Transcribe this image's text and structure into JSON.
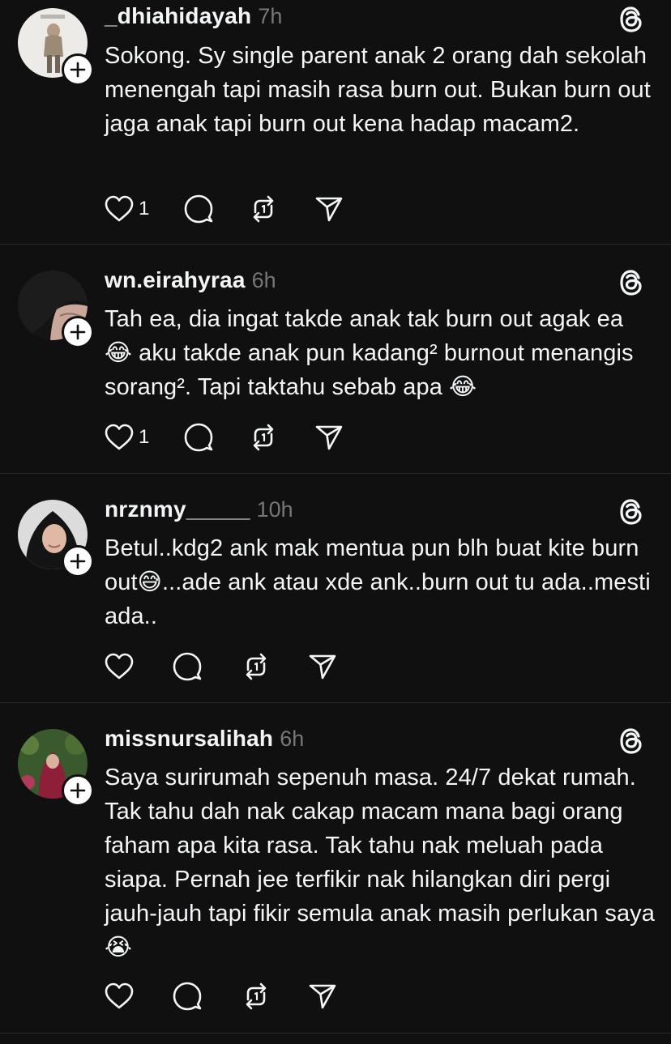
{
  "posts": [
    {
      "username": "_dhiahidayah",
      "time": "7h",
      "text": "Sokong. Sy single parent anak 2 orang dah sekolah menengah tapi masih rasa burn out. Bukan burn out jaga anak tapi burn out kena hadap macam2.",
      "likes": "1",
      "avatar_icon": "profile-photo-woman-hijab-light-background",
      "follow_icon": "plus-icon",
      "actions": [
        "heart-icon",
        "comment-icon",
        "repost-icon",
        "share-icon"
      ]
    },
    {
      "username": "wn.eirahyraa",
      "time": "6h",
      "text": "Tah ea, dia ingat takde anak tak burn out agak ea 😂  aku takde anak pun kadang² burnout menangis sorang². Tapi taktahu sebab apa 😂",
      "likes": "1",
      "avatar_icon": "profile-photo-dark-cloth",
      "follow_icon": "plus-icon",
      "actions": [
        "heart-icon",
        "comment-icon",
        "repost-icon",
        "share-icon"
      ]
    },
    {
      "username": "nrznmy_____",
      "time": "10h",
      "text": "Betul..kdg2 ank mak mentua pun blh buat kite burn out😅...ade ank atau xde ank..burn out tu ada..mesti ada..",
      "likes": "",
      "avatar_icon": "profile-photo-woman-black-hijab",
      "follow_icon": "plus-icon",
      "actions": [
        "heart-icon",
        "comment-icon",
        "repost-icon",
        "share-icon"
      ]
    },
    {
      "username": "missnursalihah",
      "time": "6h",
      "text": "Saya surirumah sepenuh masa. 24/7 dekat rumah. Tak tahu dah nak cakap macam mana bagi orang faham apa kita rasa. Tak tahu nak meluah pada siapa. Pernah jee terfikir nak hilangkan diri pergi jauh-jauh tapi fikir semula anak masih perlukan saya 😭",
      "likes": "",
      "avatar_icon": "profile-photo-woman-red-hijab-garden",
      "follow_icon": "plus-icon",
      "actions": [
        "heart-icon",
        "comment-icon",
        "repost-icon",
        "share-icon"
      ]
    }
  ],
  "app_icon": "threads-logo-icon",
  "colors": {
    "background": "#101010",
    "text": "#f3f5f7",
    "muted": "#777777",
    "divider": "#2a2a2a"
  }
}
